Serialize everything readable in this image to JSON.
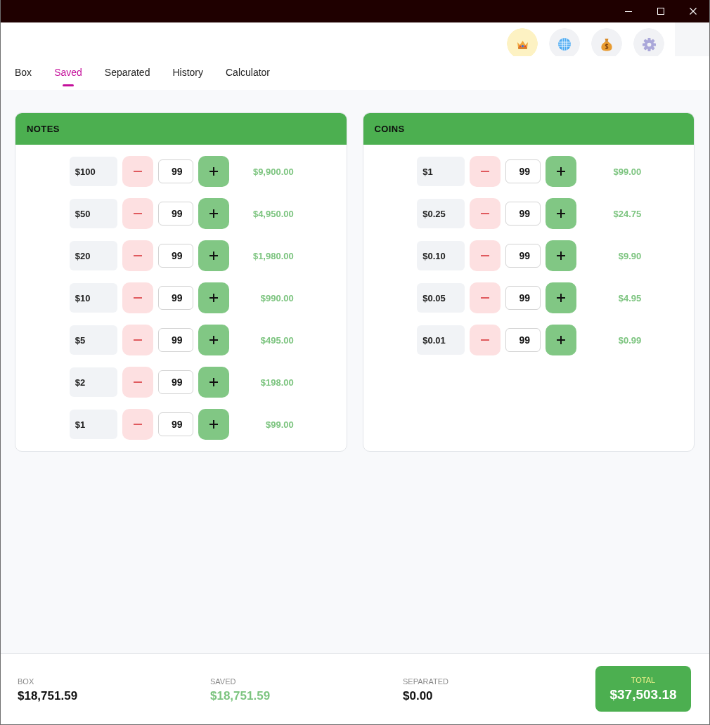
{
  "tabs": [
    {
      "label": "Box",
      "selected": false
    },
    {
      "label": "Saved",
      "selected": true
    },
    {
      "label": "Separated",
      "selected": false
    },
    {
      "label": "History",
      "selected": false
    },
    {
      "label": "Calculator",
      "selected": false
    }
  ],
  "panels": [
    {
      "title": "NOTES",
      "rows": [
        {
          "denomination": "$100",
          "count": "99",
          "amount": "$9,900.00"
        },
        {
          "denomination": "$50",
          "count": "99",
          "amount": "$4,950.00"
        },
        {
          "denomination": "$20",
          "count": "99",
          "amount": "$1,980.00"
        },
        {
          "denomination": "$10",
          "count": "99",
          "amount": "$990.00"
        },
        {
          "denomination": "$5",
          "count": "99",
          "amount": "$495.00"
        },
        {
          "denomination": "$2",
          "count": "99",
          "amount": "$198.00"
        },
        {
          "denomination": "$1",
          "count": "99",
          "amount": "$99.00"
        }
      ]
    },
    {
      "title": "COINS",
      "rows": [
        {
          "denomination": "$1",
          "count": "99",
          "amount": "$99.00"
        },
        {
          "denomination": "$0.25",
          "count": "99",
          "amount": "$24.75"
        },
        {
          "denomination": "$0.10",
          "count": "99",
          "amount": "$9.90"
        },
        {
          "denomination": "$0.05",
          "count": "99",
          "amount": "$4.95"
        },
        {
          "denomination": "$0.01",
          "count": "99",
          "amount": "$0.99"
        }
      ]
    }
  ],
  "summary": {
    "items": [
      {
        "label": "BOX",
        "value": "$18,751.59",
        "kind": "plain"
      },
      {
        "label": "SAVED",
        "value": "$18,751.59",
        "kind": "accent"
      },
      {
        "label": "SEPARATED",
        "value": "$0.00",
        "kind": "plain"
      }
    ],
    "total": {
      "label": "TOTAL",
      "value": "$37,503.18"
    }
  }
}
